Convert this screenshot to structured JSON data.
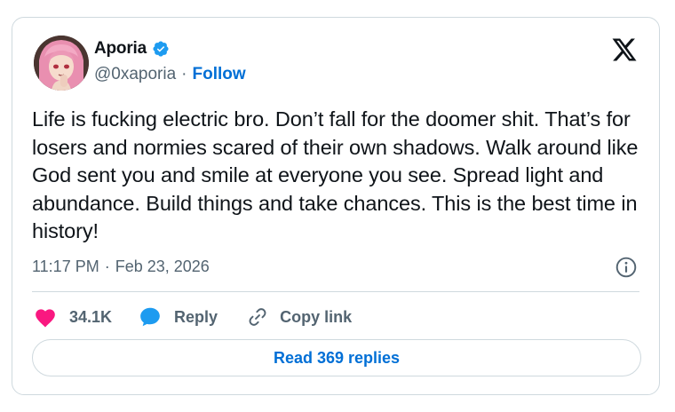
{
  "author": {
    "display_name": "Aporia",
    "handle": "@0xaporia",
    "separator": "·",
    "follow_label": "Follow",
    "verified": true
  },
  "tweet": {
    "text": "Life is fucking electric bro. Don’t fall for the doomer shit. That’s for losers and normies scared of their own shadows. Walk around like God sent you and smile at everyone you see. Spread light and abundance. Build things and take chances. This is the best time in history!",
    "time": "11:17 PM",
    "date": "Feb 23, 2026",
    "meta_separator": "·"
  },
  "actions": {
    "like_count": "34.1K",
    "reply_label": "Reply",
    "copy_link_label": "Copy link"
  },
  "read_replies_label": "Read 369 replies",
  "colors": {
    "link_blue": "#006fd6",
    "verified_blue": "#1d9bf0",
    "like_pink": "#f91880",
    "reply_blue": "#1d9bf0",
    "text_primary": "#0f1419",
    "text_secondary": "#536471",
    "border": "#cfd9de"
  },
  "icons": {
    "brand": "x-logo-icon",
    "verified": "verified-badge-icon",
    "info": "info-icon",
    "like": "heart-icon",
    "reply": "speech-bubble-icon",
    "copy_link": "link-icon"
  }
}
